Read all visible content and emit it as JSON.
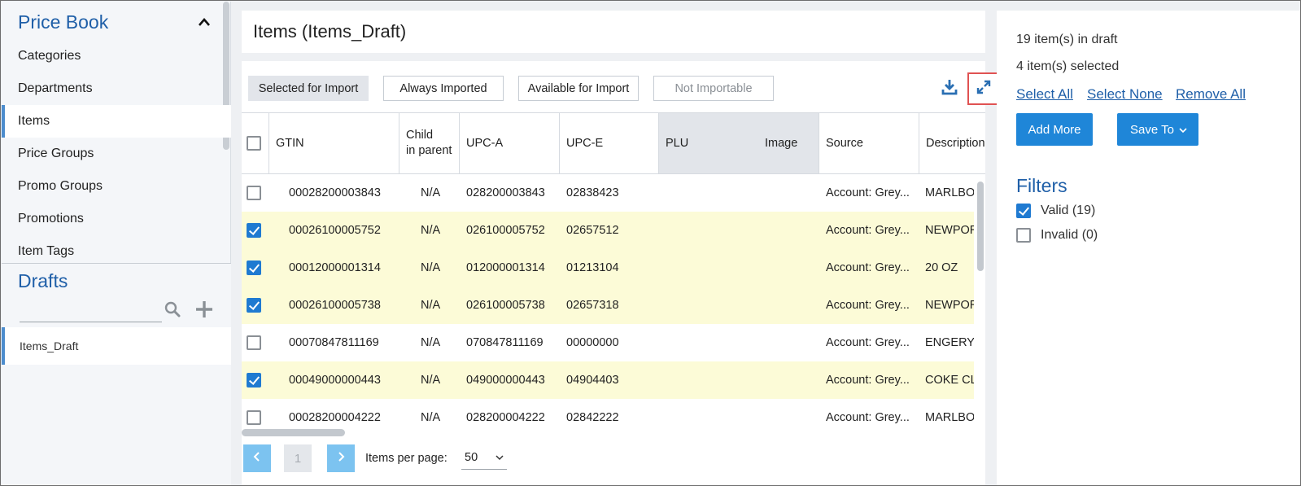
{
  "sidebar": {
    "price_book_title": "Price Book",
    "nav": [
      {
        "label": "Categories",
        "active": false
      },
      {
        "label": "Departments",
        "active": false
      },
      {
        "label": "Items",
        "active": true
      },
      {
        "label": "Price Groups",
        "active": false
      },
      {
        "label": "Promo Groups",
        "active": false
      },
      {
        "label": "Promotions",
        "active": false
      },
      {
        "label": "Item Tags",
        "active": false
      }
    ],
    "drafts_title": "Drafts",
    "search_value": "",
    "draft_items": [
      "Items_Draft"
    ]
  },
  "main": {
    "title": "Items (Items_Draft)",
    "filter_tabs": [
      "Selected for Import",
      "Always Imported",
      "Available for Import",
      "Not Importable"
    ],
    "columns": {
      "gtin": "GTIN",
      "child_line1": "Child",
      "child_line2": "in parent",
      "upca": "UPC-A",
      "upce": "UPC-E",
      "plu": "PLU",
      "image": "Image",
      "source": "Source",
      "description": "Description"
    },
    "rows": [
      {
        "checked": false,
        "gtin": "00028200003843",
        "child": "N/A",
        "upca": "028200003843",
        "upce": "02838423",
        "source": "Account: Grey...",
        "description": "MARLBORO"
      },
      {
        "checked": true,
        "gtin": "00026100005752",
        "child": "N/A",
        "upca": "026100005752",
        "upce": "02657512",
        "source": "Account: Grey...",
        "description": "NEWPORT"
      },
      {
        "checked": true,
        "gtin": "00012000001314",
        "child": "N/A",
        "upca": "012000001314",
        "upce": "01213104",
        "source": "Account: Grey...",
        "description": "20 OZ"
      },
      {
        "checked": true,
        "gtin": "00026100005738",
        "child": "N/A",
        "upca": "026100005738",
        "upce": "02657318",
        "source": "Account: Grey...",
        "description": "NEWPORT"
      },
      {
        "checked": false,
        "gtin": "00070847811169",
        "child": "N/A",
        "upca": "070847811169",
        "upce": "00000000",
        "source": "Account: Grey...",
        "description": "ENGERY D"
      },
      {
        "checked": true,
        "gtin": "00049000000443",
        "child": "N/A",
        "upca": "049000000443",
        "upce": "04904403",
        "source": "Account: Grey...",
        "description": "COKE CLS"
      },
      {
        "checked": false,
        "gtin": "00028200004222",
        "child": "N/A",
        "upca": "028200004222",
        "upce": "02842222",
        "source": "Account: Grey...",
        "description": "MARLBORO"
      }
    ],
    "pager": {
      "page": "1",
      "items_per_page_label": "Items per page:",
      "items_per_page": "50"
    }
  },
  "right": {
    "draft_count": "19 item(s) in draft",
    "selected_count": "4 item(s) selected",
    "select_all": "Select All",
    "select_none": "Select None",
    "remove_all": "Remove All",
    "add_more": "Add More",
    "save_to": "Save To",
    "filters_title": "Filters",
    "filters": [
      {
        "label": "Valid (19)",
        "checked": true
      },
      {
        "label": "Invalid (0)",
        "checked": false
      }
    ]
  },
  "colors": {
    "accent": "#1f86d8",
    "title_blue": "#1f5fa8",
    "selected_row": "#fcfbd7",
    "highlight": "#e05252"
  }
}
